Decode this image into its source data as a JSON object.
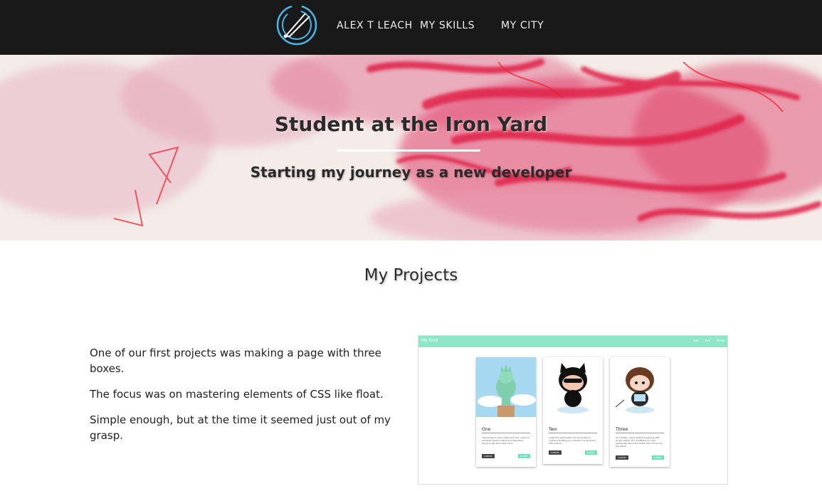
{
  "nav": {
    "brand": "ALEX T LEACH",
    "skills": "MY SKILLS",
    "city": "MY CITY",
    "logo_icon": "tuning-fork-circle-icon"
  },
  "hero": {
    "title": "Student at the Iron Yard",
    "subtitle": "Starting my journey as a new developer"
  },
  "projects": {
    "heading": "My Projects",
    "paragraphs": [
      "One of our first projects was making a page with three boxes.",
      "The focus was on mastering elements of CSS like float.",
      "Simple enough, but at the time it seemed just out of my grasp."
    ],
    "screenshot": {
      "brand": "My Grid",
      "links": "one two three",
      "cards": [
        {
          "title": "One",
          "text": "I would like to live in New York City. I spent a semester there in 2014 and have been trying to get back ever since.",
          "cancel": "CANCEL",
          "submit": "SUBMIT"
        },
        {
          "title": "Two",
          "text": "I play the synthesizer and would like to continue building my collection of electronic instruments.",
          "cancel": "CANCEL",
          "submit": "SUBMIT"
        },
        {
          "title": "Three",
          "text": "As a hobby I enjoy abstract painting with acrylic paints. It's something I'm very passionate about but at the same time very shy about.",
          "cancel": "CANCEL",
          "submit": "SUBMIT"
        }
      ]
    }
  },
  "colors": {
    "navbar": "#191919",
    "accent_logo": "#4cb6e8",
    "paint_red": "#e0214a",
    "mint": "#8de6c8"
  }
}
